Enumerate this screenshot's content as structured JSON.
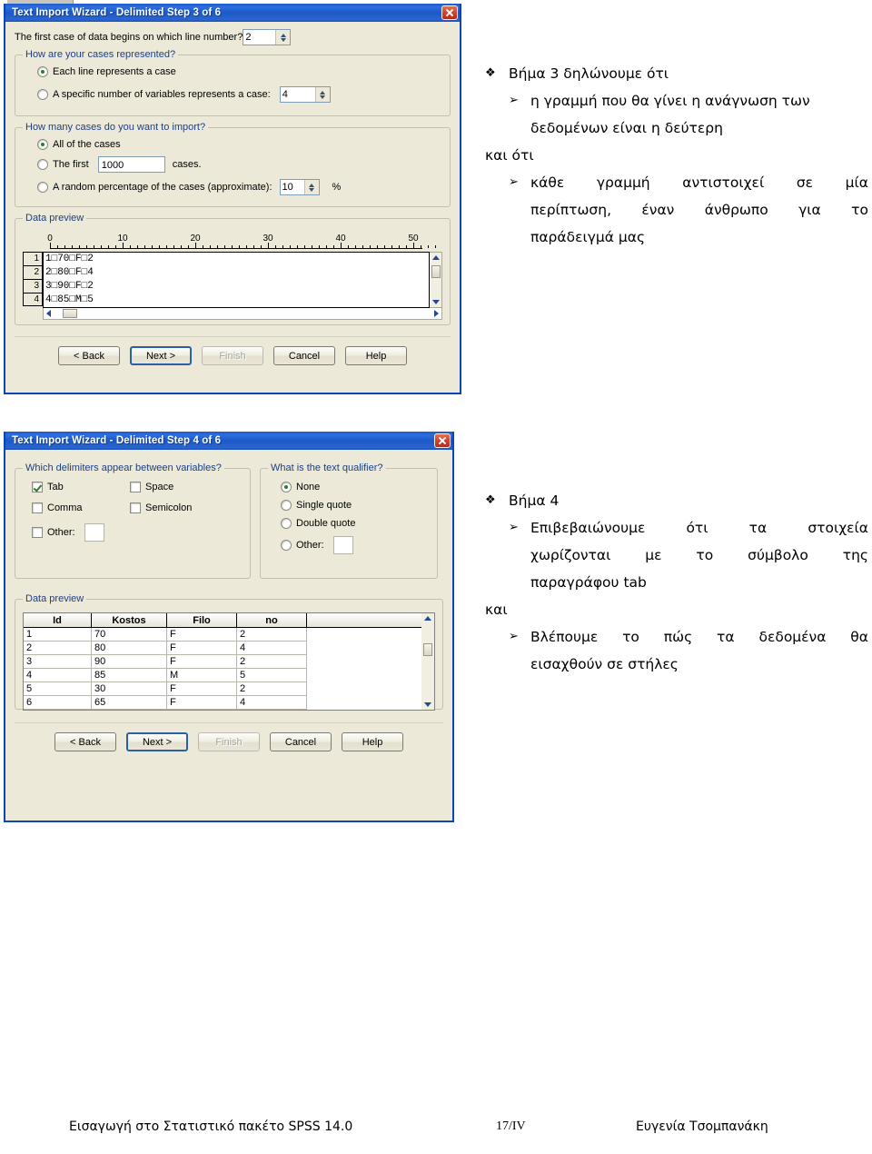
{
  "page": {
    "footer": {
      "left": "Εισαγωγή στο Στατιστικό πακέτο SPSS 14.0",
      "middle": "17/IV",
      "right": "Ευγενία Τσομπανάκη"
    }
  },
  "dialog3": {
    "title": "Text Import Wizard - Delimited Step 3 of 6",
    "close_label": "×",
    "first_case_question": "The first case of data begins on which line number?",
    "first_case_value": "2",
    "cases_represented": {
      "legend": "How are your cases represented?",
      "option_each_line": "Each line represents a case",
      "option_each_line_selected": true,
      "option_specific": "A specific number of variables represents a case:",
      "option_specific_selected": false,
      "specific_value": "4"
    },
    "how_many_cases": {
      "legend": "How many cases do you want to import?",
      "option_all": "All of the cases",
      "option_all_selected": true,
      "option_first_prefix": "The first",
      "option_first_value": "1000",
      "option_first_suffix": "cases.",
      "option_first_selected": false,
      "option_random": "A random percentage of the cases (approximate):",
      "option_random_value": "10",
      "option_random_suffix": "%",
      "option_random_selected": false
    },
    "data_preview": {
      "legend": "Data preview",
      "ruler_labels": [
        "0",
        "10",
        "20",
        "30",
        "40",
        "50"
      ],
      "line_numbers": [
        "1",
        "2",
        "3",
        "4"
      ],
      "lines": [
        "1□70□F□2",
        "2□80□F□4",
        "3□90□F□2",
        "4□85□M□5"
      ]
    },
    "buttons": {
      "back": "< Back",
      "next": "Next >",
      "finish": "Finish",
      "cancel": "Cancel",
      "help": "Help"
    }
  },
  "dialog4": {
    "title": "Text Import Wizard - Delimited Step 4 of 6",
    "close_label": "×",
    "delimiters": {
      "legend": "Which delimiters appear between variables?",
      "tab": "Tab",
      "tab_checked": true,
      "space": "Space",
      "space_checked": false,
      "comma": "Comma",
      "comma_checked": false,
      "semicolon": "Semicolon",
      "semicolon_checked": false,
      "other": "Other:",
      "other_checked": false,
      "other_value": ""
    },
    "qualifier": {
      "legend": "What is the text qualifier?",
      "none": "None",
      "none_selected": true,
      "single": "Single quote",
      "single_selected": false,
      "double": "Double quote",
      "double_selected": false,
      "other": "Other:",
      "other_selected": false,
      "other_value": ""
    },
    "data_preview": {
      "legend": "Data preview",
      "columns": [
        "Id",
        "Kostos",
        "Filo",
        "no"
      ],
      "rows": [
        [
          "1",
          "70",
          "F",
          "2"
        ],
        [
          "2",
          "80",
          "F",
          "4"
        ],
        [
          "3",
          "90",
          "F",
          "2"
        ],
        [
          "4",
          "85",
          "M",
          "5"
        ],
        [
          "5",
          "30",
          "F",
          "2"
        ],
        [
          "6",
          "65",
          "F",
          "4"
        ]
      ]
    },
    "buttons": {
      "back": "< Back",
      "next": "Next >",
      "finish": "Finish",
      "cancel": "Cancel",
      "help": "Help"
    }
  },
  "notes": {
    "block1": {
      "heading_mark": "❖",
      "heading": "Βήμα 3 δηλώνουμε ότι",
      "sub_mark": "➢",
      "sub1_line1": "η γραμμή που θα γίνει η ανάγνωση των",
      "sub1_line2": "δεδομένων είναι η δεύτερη",
      "connector": "και ότι",
      "sub2_line1": "κάθε γραμμή αντιστοιχεί σε μία",
      "sub2_line2": "περίπτωση, έναν άνθρωπο για το",
      "sub2_line3": "παράδειγμά μας"
    },
    "block2": {
      "heading_mark": "❖",
      "heading": "Βήμα 4",
      "sub_mark": "➢",
      "sub1_line1": "Επιβεβαιώνουμε ότι τα στοιχεία",
      "sub1_line2": "χωρίζονται με το σύμβολο της",
      "sub1_line3": "παραγράφου tab",
      "connector": "και",
      "sub2_line1": "Βλέπουμε το πώς τα δεδομένα θα",
      "sub2_line2": "εισαχθούν σε στήλες"
    }
  }
}
